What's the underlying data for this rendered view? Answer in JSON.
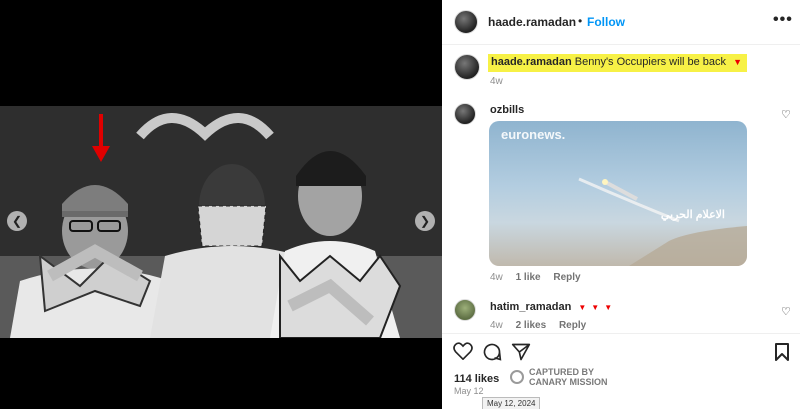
{
  "post": {
    "username": "haade.ramadan",
    "separator": "•",
    "follow_label": "Follow",
    "more_label": "•••"
  },
  "caption": {
    "username": "haade.ramadan",
    "text": "Benny's Occupiers will be back",
    "marker": "▼",
    "time": "4w",
    "highlight_color": "#f7f146"
  },
  "comments": [
    {
      "username": "ozbills",
      "image": {
        "logo": "euronews.",
        "overlay_text": "الاعلام الحربي"
      },
      "time": "4w",
      "likes": "1 like",
      "reply_label": "Reply"
    },
    {
      "username": "hatim_ramadan",
      "markers": "▼▼▼",
      "time": "4w",
      "likes": "2 likes",
      "reply_label": "Reply"
    }
  ],
  "footer": {
    "likes": "114 likes",
    "date": "May 12",
    "tooltip": "May 12, 2024",
    "watermark_line1": "CAPTURED BY",
    "watermark_line2": "CANARY MISSION"
  },
  "colors": {
    "accent": "#0095f6",
    "marker_red": "#e00000"
  },
  "icons": [
    "chevron-left-icon",
    "chevron-right-icon",
    "more-icon",
    "heart-icon",
    "comment-icon",
    "share-icon",
    "bookmark-icon"
  ]
}
